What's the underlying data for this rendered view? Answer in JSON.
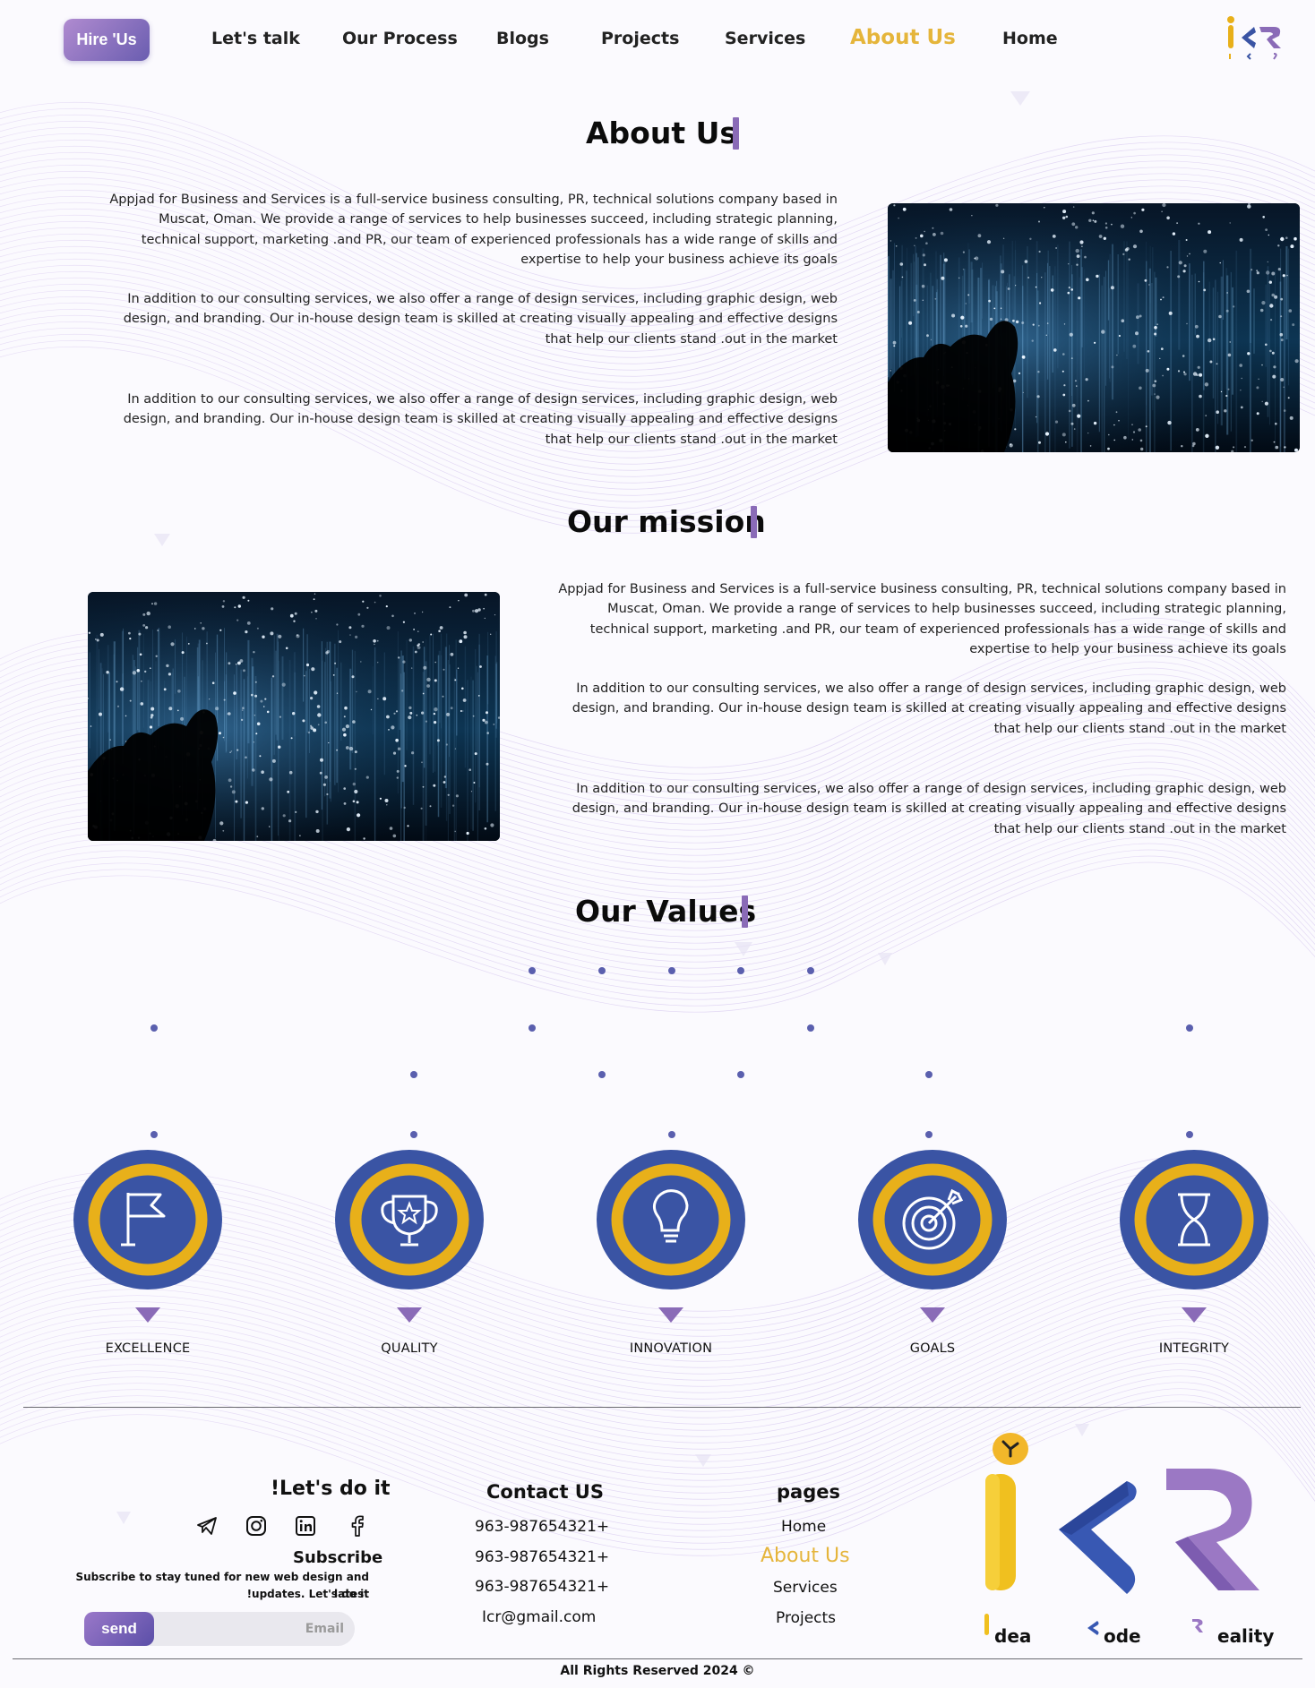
{
  "nav": {
    "hire_label": "Hire 'Us",
    "links": [
      "Let's talk",
      "Our Process",
      "Blogs",
      "Projects",
      "Services",
      "About Us",
      "Home"
    ],
    "active_link": "About Us",
    "accent_color": "#e5b53b"
  },
  "about": {
    "title": "About Us",
    "paragraphs": [
      "Appjad for Business and Services is a full-service business consulting, PR, technical solutions company based in Muscat, Oman. We provide a range of services to help businesses succeed, including strategic planning, technical support, marketing .and PR, our team of experienced professionals has a wide range of skills and expertise to help your business achieve its goals",
      "In addition to our consulting services, we also offer a range of design services, including graphic design, web design, and branding. Our in-house design team is skilled at creating visually appealing and effective designs that help our clients stand .out in the market",
      "In addition to our consulting services, we also offer a range of design services, including graphic design, web design, and branding. Our in-house design team is skilled at creating visually appealing and effective designs that help our clients stand .out in the market"
    ]
  },
  "mission": {
    "title": "Our mission",
    "paragraphs": [
      "Appjad for Business and Services is a full-service business consulting, PR, technical solutions company based in Muscat, Oman. We provide a range of services to help businesses succeed, including strategic planning, technical support, marketing .and PR, our team of experienced professionals has a wide range of skills and expertise to help your business achieve its goals",
      "In addition to our consulting services, we also offer a range of design services, including graphic design, web design, and branding. Our in-house design team is skilled at creating visually appealing and effective designs that help our clients stand .out in the market",
      "In addition to our consulting services, we also offer a range of design services, including graphic design, web design, and branding. Our in-house design team is skilled at creating visually appealing and effective designs that help our clients stand .out in the market"
    ]
  },
  "values": {
    "title": "Our Values",
    "items": [
      {
        "label": "EXCELLENCE",
        "icon": "flag-icon"
      },
      {
        "label": "QUALITY",
        "icon": "trophy-icon"
      },
      {
        "label": "INNOVATION",
        "icon": "lightbulb-icon"
      },
      {
        "label": "GOALS",
        "icon": "target-icon"
      },
      {
        "label": "INTEGRITY",
        "icon": "hourglass-icon"
      }
    ],
    "circle_color": "#3a54a4",
    "ring_color": "#e8b01a",
    "pointer_color": "#8a6bb7"
  },
  "footer": {
    "lets_do_it": "!Let's do it",
    "social_icons": [
      "telegram-icon",
      "instagram-icon",
      "linkedin-icon",
      "facebook-icon"
    ],
    "subscribe_title": "Subscribe",
    "subscribe_text_1": "Subscribe to stay tuned for new web design and latest",
    "subscribe_text_2": "!updates. Let's do it",
    "email_placeholder": "Email",
    "send_label": "send",
    "contact_title": "Contact US",
    "phones": [
      "963-987654321+",
      "963-987654321+",
      "963-987654321+"
    ],
    "email": "Icr@gmail.com",
    "pages_title": "pages",
    "pages": [
      "Home",
      "About Us",
      "Services",
      "Projects"
    ],
    "active_page": "About Us",
    "logo_words": [
      "dea",
      "ode",
      "eality"
    ],
    "copyright": "All Rights Reserved 2024 ©"
  }
}
